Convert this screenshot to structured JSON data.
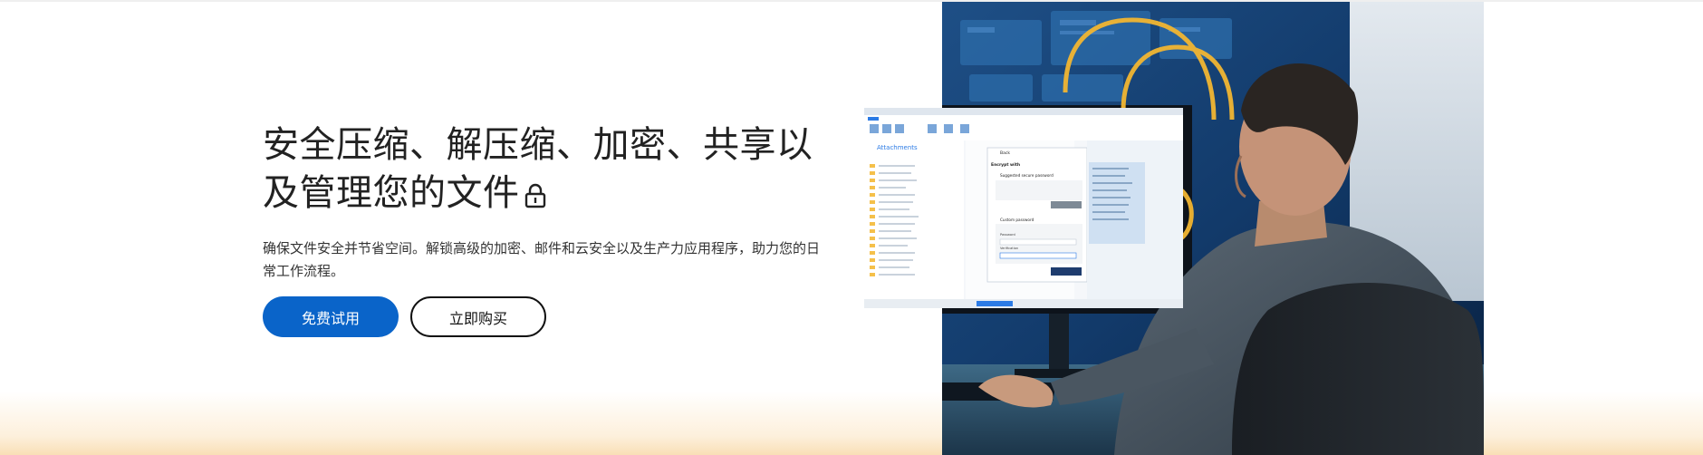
{
  "hero": {
    "title": "安全压缩、解压缩、加密、共享以及管理您的文件",
    "subtitle": "确保文件安全并节省空间。解锁高级的加密、邮件和云安全以及生产力应用程序，助力您的日常工作流程。",
    "lock_icon": "padlock-icon"
  },
  "cta": {
    "primary_label": "免费试用",
    "secondary_label": "立即购买"
  },
  "screen": {
    "folder_title": "Attachments",
    "back_label": "Back",
    "panel_title": "Encrypt with",
    "option_suggested": "Suggested secure password",
    "option_custom": "Custom password",
    "password_label": "Password",
    "verification_label": "Verification"
  },
  "colors": {
    "primary_blue": "#0a64c9",
    "lock_outline": "#f2b632"
  }
}
